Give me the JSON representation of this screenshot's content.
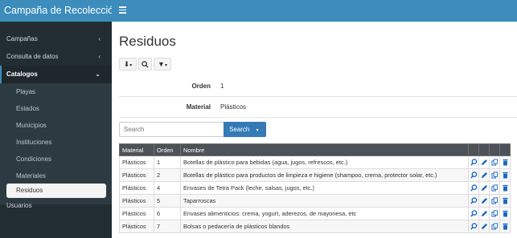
{
  "sidebar": {
    "brand": "Campaña de Recolección",
    "items": [
      {
        "label": "Campañas",
        "chevron": "‹"
      },
      {
        "label": "Consulta de datos",
        "chevron": "‹"
      },
      {
        "label": "Catalogos",
        "chevron": "⌄"
      }
    ],
    "catalogos": [
      "Playas",
      "Estados",
      "Municipios",
      "Instituciones",
      "Condiciones",
      "Materiales",
      "Residuos"
    ],
    "usuarios": "Usuarios"
  },
  "page": {
    "title": "Residuos",
    "orden_label": "Orden",
    "orden_value": "1",
    "material_label": "Material",
    "material_value": "Plásticos",
    "search_placeholder": "Search",
    "search_button": "Search"
  },
  "table": {
    "headers": [
      "Material",
      "Orden",
      "Nombre"
    ],
    "rows": [
      {
        "material": "Plásticos",
        "orden": "1",
        "nombre": "Botellas de plástico para bebidas (agua, jugos, refrescos, etc.)"
      },
      {
        "material": "Plásticos",
        "orden": "2",
        "nombre": "Botellas de plástico para productos de limpieza e higiene (shampoo, crema, protector solar, etc.)"
      },
      {
        "material": "Plásticos",
        "orden": "4",
        "nombre": "Envases de Tetra Pack (leche, salsas, jugos, etc.)"
      },
      {
        "material": "Plásticos",
        "orden": "5",
        "nombre": "Taparroscas"
      },
      {
        "material": "Plásticos",
        "orden": "6",
        "nombre": "Envases alimenticios: crema, yogurt, aderezos, de mayonesa, etc"
      },
      {
        "material": "Plásticos",
        "orden": "7",
        "nombre": "Bolsas o pedacería de plásticos blandos"
      }
    ]
  },
  "colors": {
    "primary": "#3c8dbc",
    "sidebar": "#222d32",
    "button": "#337ab7",
    "action": "#1a66c4"
  }
}
